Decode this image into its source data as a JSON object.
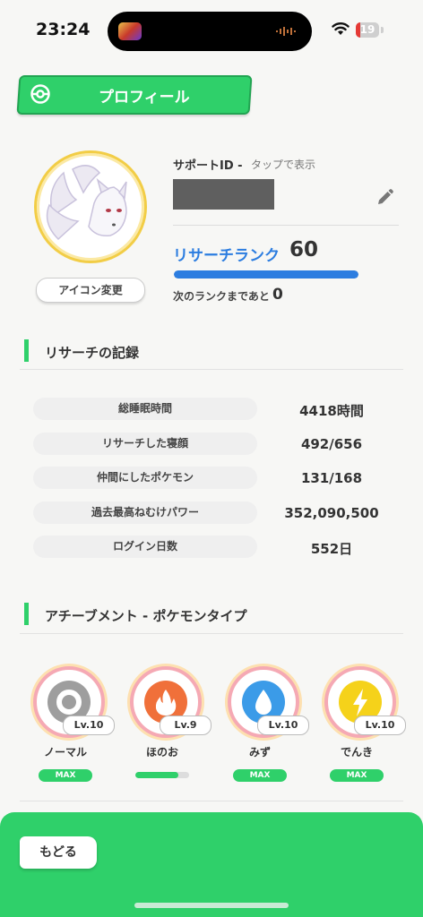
{
  "status_bar": {
    "time": "23:24",
    "battery": "19",
    "battery_level": 0.19
  },
  "header": {
    "title": "プロフィール",
    "icon": "pokeball-icon"
  },
  "profile": {
    "change_icon_label": "アイコン変更",
    "support_id_label": "サポートID -",
    "support_id_hint": "タップで表示",
    "rank_label": "リサーチランク",
    "rank_value": "60",
    "rank_progress": 1.0,
    "next_rank_label": "次のランクまであと",
    "next_rank_value": "0"
  },
  "records": {
    "title": "リサーチの記録",
    "items": [
      {
        "label": "総睡眠時間",
        "value": "4418時間"
      },
      {
        "label": "リサーチした寝顔",
        "value": "492/656"
      },
      {
        "label": "仲間にしたポケモン",
        "value": "131/168"
      },
      {
        "label": "過去最高ねむけパワー",
        "value": "352,090,500"
      },
      {
        "label": "ログイン日数",
        "value": "552日"
      }
    ]
  },
  "achievements": {
    "title": "アチーブメント - ポケモンタイプ",
    "items": [
      {
        "name": "ノーマル",
        "level": "Lv.10",
        "status": "MAX",
        "icon": "normal-type-icon",
        "color": "#9e9e9e"
      },
      {
        "name": "ほのお",
        "level": "Lv.9",
        "progress": 0.8,
        "icon": "fire-type-icon",
        "color": "#f0703a"
      },
      {
        "name": "みず",
        "level": "Lv.10",
        "status": "MAX",
        "icon": "water-type-icon",
        "color": "#3b9be8"
      },
      {
        "name": "でんき",
        "level": "Lv.10",
        "status": "MAX",
        "icon": "electric-type-icon",
        "color": "#f5d21a"
      }
    ]
  },
  "footer": {
    "back_label": "もどる"
  },
  "colors": {
    "accent_green": "#2fd06a",
    "rank_blue": "#2c7de0"
  }
}
